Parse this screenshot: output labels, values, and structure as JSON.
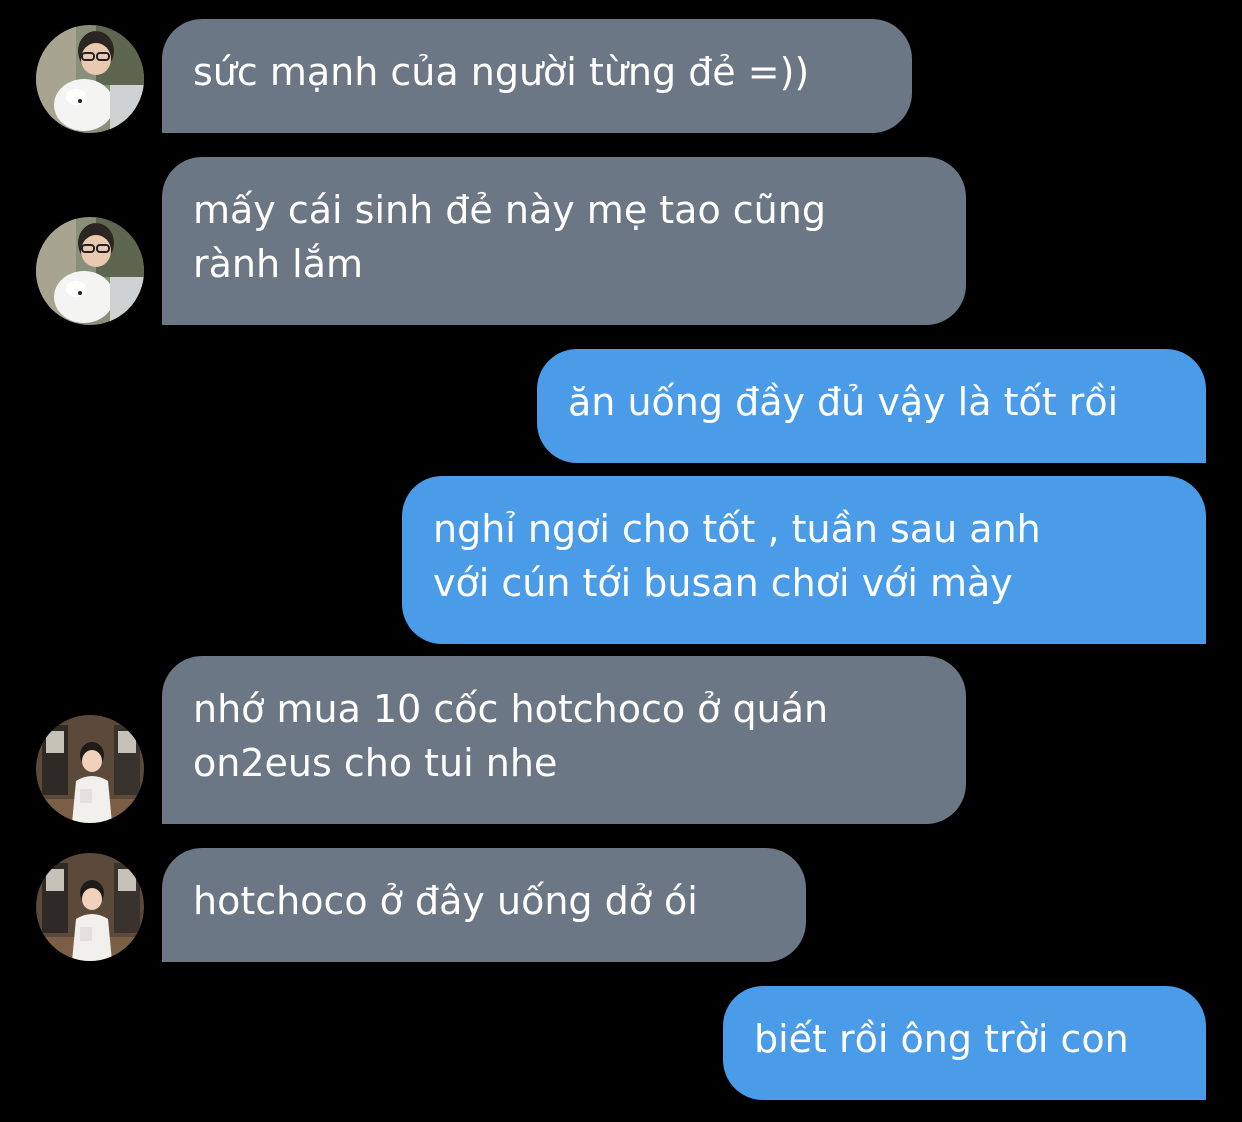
{
  "colors": {
    "background": "#000000",
    "incoming_bubble": "#6b7784",
    "outgoing_bubble": "#4a9be8",
    "text": "#ffffff"
  },
  "messages": [
    {
      "direction": "incoming",
      "sender": "contact-a",
      "lines": [
        "sức mạnh của người từng đẻ =))"
      ]
    },
    {
      "direction": "incoming",
      "sender": "contact-a",
      "lines": [
        "mấy cái sinh đẻ này mẹ tao cũng",
        "rành lắm"
      ]
    },
    {
      "direction": "outgoing",
      "lines": [
        "ăn uống đầy đủ vậy là tốt rồi"
      ]
    },
    {
      "direction": "outgoing",
      "lines": [
        "nghỉ ngơi cho tốt , tuần sau anh",
        "với cún tới busan chơi với mày"
      ]
    },
    {
      "direction": "incoming",
      "sender": "contact-b",
      "lines": [
        "nhớ mua 10 cốc hotchoco ở quán",
        "on2eus cho tui nhe"
      ]
    },
    {
      "direction": "incoming",
      "sender": "contact-b",
      "lines": [
        "hotchoco ở đây uống dở ói"
      ]
    },
    {
      "direction": "outgoing",
      "lines": [
        "biết rồi ông trời con"
      ]
    }
  ]
}
